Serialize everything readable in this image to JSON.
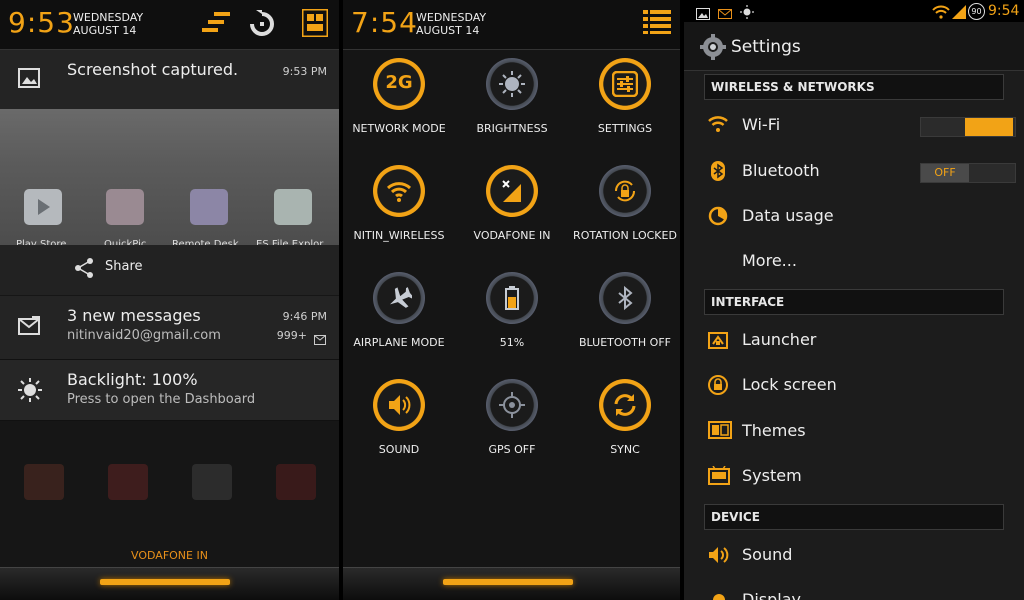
{
  "panel1": {
    "time": "9:53",
    "day": "WEDNESDAY",
    "date": "AUGUST 14",
    "notifications": [
      {
        "title": "Screenshot captured.",
        "time": "9:53 PM"
      },
      {
        "title": "3 new messages",
        "sub": "nitinvaid20@gmail.com",
        "time": "9:46 PM",
        "count": "999+"
      },
      {
        "title": "Backlight: 100%",
        "sub": "Press to open the Dashboard"
      }
    ],
    "share_label": "Share",
    "apps": [
      "Play Store",
      "QuickPic",
      "Remote Desk...",
      "ES File Explor..."
    ],
    "carrier": "VODAFONE IN"
  },
  "panel2": {
    "time": "7:54",
    "day": "WEDNESDAY",
    "date": "AUGUST 14",
    "toggles": [
      {
        "label": "NETWORK MODE",
        "icon": "network-2g-icon",
        "state": "on",
        "glyph": "2G"
      },
      {
        "label": "BRIGHTNESS",
        "icon": "brightness-icon",
        "state": "off"
      },
      {
        "label": "SETTINGS",
        "icon": "settings-sliders-icon",
        "state": "on"
      },
      {
        "label": "NITIN_WIRELESS",
        "icon": "wifi-icon",
        "state": "on"
      },
      {
        "label": "VODAFONE IN",
        "icon": "signal-icon",
        "state": "on"
      },
      {
        "label": "ROTATION LOCKED",
        "icon": "rotation-lock-icon",
        "state": "off"
      },
      {
        "label": "AIRPLANE MODE",
        "icon": "airplane-icon",
        "state": "off"
      },
      {
        "label": "51%",
        "icon": "battery-icon",
        "state": "off"
      },
      {
        "label": "BLUETOOTH OFF",
        "icon": "bluetooth-icon",
        "state": "off"
      },
      {
        "label": "SOUND",
        "icon": "sound-icon",
        "state": "on"
      },
      {
        "label": "GPS OFF",
        "icon": "gps-icon",
        "state": "off"
      },
      {
        "label": "SYNC",
        "icon": "sync-icon",
        "state": "on"
      }
    ]
  },
  "panel3": {
    "status_time": "9:54",
    "status_badge": "90",
    "title": "Settings",
    "sections": [
      {
        "header": "WIRELESS & NETWORKS",
        "items": [
          "Wi-Fi",
          "Bluetooth",
          "Data usage",
          "More..."
        ]
      },
      {
        "header": "INTERFACE",
        "items": [
          "Launcher",
          "Lock screen",
          "Themes",
          "System"
        ]
      },
      {
        "header": "DEVICE",
        "items": [
          "Sound",
          "Display"
        ]
      }
    ],
    "bluetooth_switch": "OFF",
    "accent": "#f2a316"
  }
}
